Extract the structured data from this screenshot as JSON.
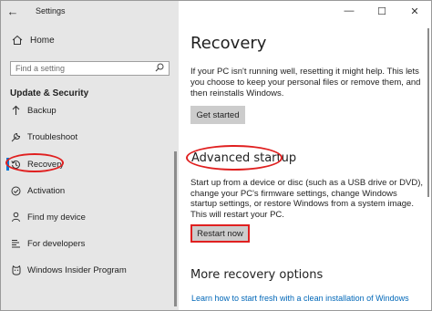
{
  "window": {
    "title": "Settings",
    "controls": [
      "—",
      "☐",
      "✕"
    ]
  },
  "sidebar": {
    "home_label": "Home",
    "search_placeholder": "Find a setting",
    "section_title": "Update & Security",
    "items": [
      {
        "label": "Backup",
        "icon": "backup-icon",
        "selected": false
      },
      {
        "label": "Troubleshoot",
        "icon": "wrench-icon",
        "selected": false
      },
      {
        "label": "Recovery",
        "icon": "recovery-icon",
        "selected": true
      },
      {
        "label": "Activation",
        "icon": "check-circle-icon",
        "selected": false
      },
      {
        "label": "Find my device",
        "icon": "person-locate-icon",
        "selected": false
      },
      {
        "label": "For developers",
        "icon": "developer-tools-icon",
        "selected": false
      },
      {
        "label": "Windows Insider Program",
        "icon": "insider-cat-icon",
        "selected": false
      }
    ]
  },
  "main": {
    "title": "Recovery",
    "reset_text": "If your PC isn't running well, resetting it might help. This lets you choose to keep your personal files or remove them, and then reinstalls Windows.",
    "get_started_label": "Get started",
    "advanced_title": "Advanced startup",
    "advanced_text": "Start up from a device or disc (such as a USB drive or DVD), change your PC's firmware settings, change Windows startup settings, or restore Windows from a system image. This will restart your PC.",
    "restart_label": "Restart now",
    "more_title": "More recovery options",
    "link_text": "Learn how to start fresh with a clean installation of Windows"
  },
  "colors": {
    "accent": "#0078d7",
    "highlight": "#e02020",
    "link": "#0067b8"
  }
}
